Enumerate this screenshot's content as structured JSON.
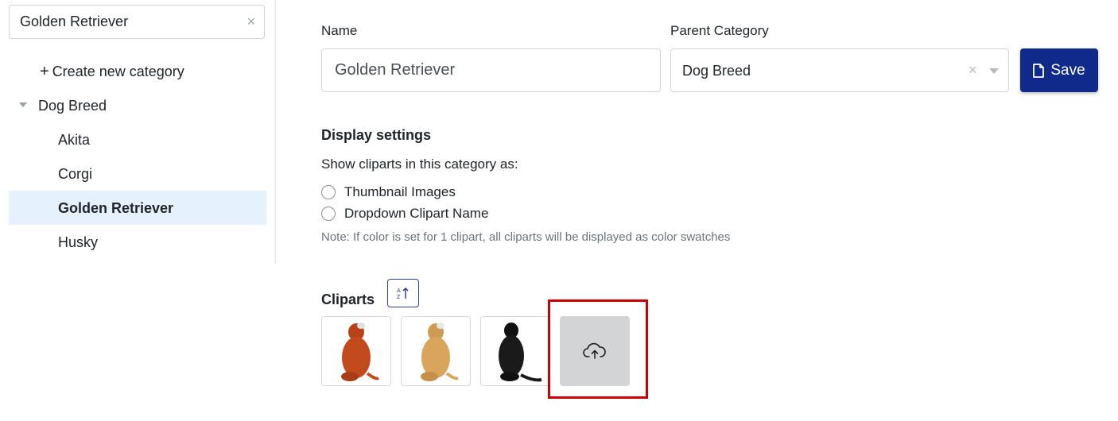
{
  "sidebar": {
    "search": {
      "value": "Golden Retriever",
      "clear_icon": "×"
    },
    "create_label": "Create new category",
    "create_icon": "+",
    "root": {
      "label": "Dog Breed",
      "icon": "caret-down"
    },
    "children": [
      {
        "label": "Akita"
      },
      {
        "label": "Corgi"
      },
      {
        "label": "Golden Retriever",
        "selected": true
      },
      {
        "label": "Husky"
      }
    ]
  },
  "form": {
    "name_label": "Name",
    "name_value": "Golden Retriever",
    "parent_label": "Parent Category",
    "parent_value": "Dog Breed",
    "parent_clear_icon": "×",
    "save_label": "Save"
  },
  "display": {
    "heading": "Display settings",
    "prompt": "Show cliparts in this category as:",
    "options": [
      {
        "label": "Thumbnail Images",
        "checked": false
      },
      {
        "label": "Dropdown Clipart Name",
        "checked": false
      }
    ],
    "note": "Note: If color is set for 1 clipart, all cliparts will be displayed as color swatches"
  },
  "cliparts": {
    "heading": "Cliparts",
    "sort_icon": "sort-alpha-icon",
    "items": [
      {
        "name": "golden-retriever-red-clipart",
        "color": "#c24a1c"
      },
      {
        "name": "golden-retriever-light-clipart",
        "color": "#d9a45c"
      },
      {
        "name": "golden-retriever-black-clipart",
        "color": "#1a1a1a"
      }
    ],
    "upload_icon": "cloud-upload-icon"
  },
  "colors": {
    "accent": "#102a8c",
    "selected_bg": "#e5f1fc",
    "highlight": "#cc0000"
  }
}
